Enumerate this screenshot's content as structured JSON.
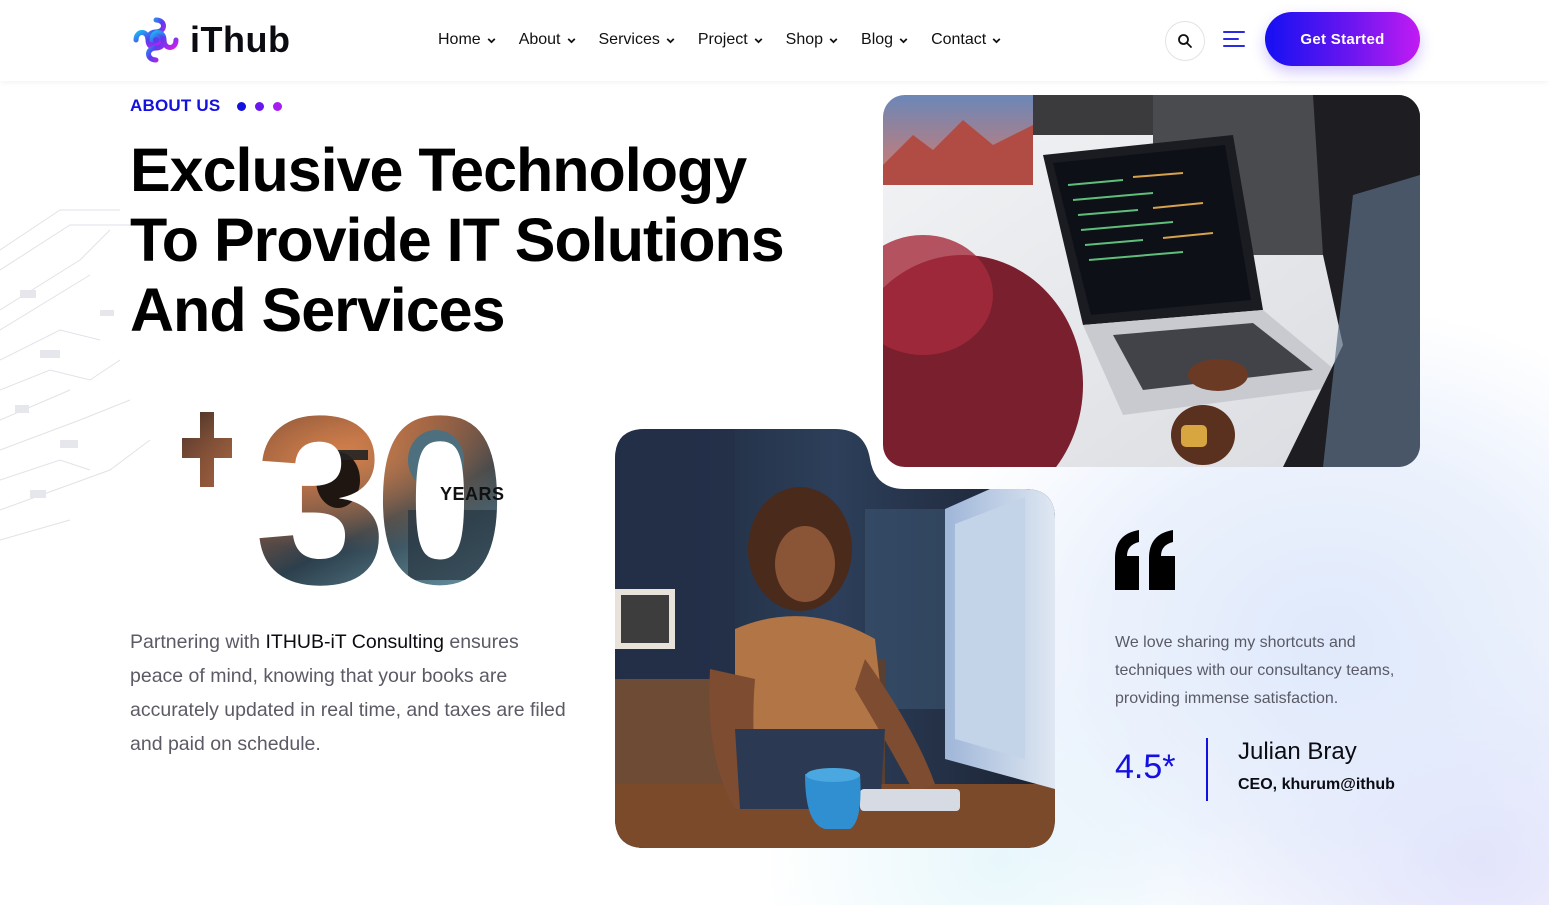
{
  "brand": {
    "name": "iThub",
    "accent": "#1410e0",
    "gradient_start": "#1410f2",
    "gradient_end": "#c21bf2"
  },
  "nav": {
    "items": [
      {
        "label": "Home",
        "icon": "chevron-down-icon"
      },
      {
        "label": "About",
        "icon": "chevron-down-icon"
      },
      {
        "label": "Services",
        "icon": "chevron-down-icon"
      },
      {
        "label": "Project",
        "icon": "chevron-down-icon"
      },
      {
        "label": "Shop",
        "icon": "chevron-down-icon"
      },
      {
        "label": "Blog",
        "icon": "chevron-down-icon"
      },
      {
        "label": "Contact",
        "icon": "chevron-down-icon"
      }
    ],
    "search_icon": "search-icon",
    "menu_icon": "hamburger-menu-icon",
    "cta_label": "Get Started"
  },
  "about": {
    "eyebrow": "ABOUT US",
    "dot_colors": [
      "#1410e0",
      "#6a16f0",
      "#a81cf2"
    ],
    "headline_lines": [
      "Exclusive Technology",
      "To Provide IT Solutions",
      "And Services"
    ],
    "years_value": "+30",
    "years_label": "YEARS",
    "body_pre": "Partnering with ",
    "body_strong": "ITHUB-iT Consulting",
    "body_post": " ensures peace of mind, knowing that your books are accurately updated in real time, and taxes are filed and paid on schedule."
  },
  "testimonial": {
    "quote_icon": "quote-icon",
    "text": "We love sharing my shortcuts and techniques with our consultancy teams, providing immense satisfaction.",
    "rating": "4.5*",
    "author_name": "Julian Bray",
    "author_role": "CEO, khurum@ithub"
  },
  "images": {
    "photo_top": "photo-developers-laptop",
    "photo_bottom": "photo-woman-at-computer"
  }
}
